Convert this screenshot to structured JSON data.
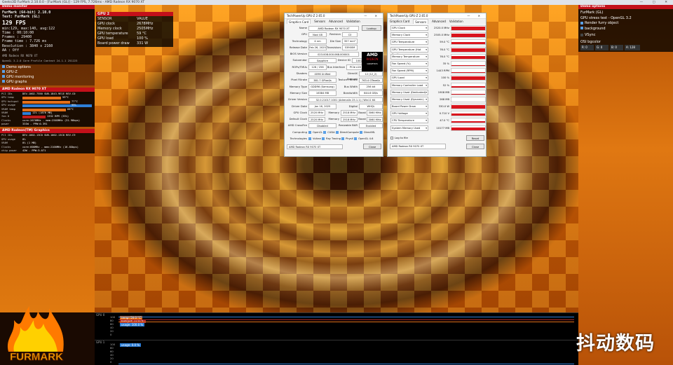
{
  "titlebar": {
    "text": "Geeks3D FurMark 2.10.0.0 - [FurMark (GL)] - 129 FPS, 7.726ms - AMD Radeon RX 9070 XT",
    "controls": "— ▢ ✕"
  },
  "left": {
    "demo_monitor_header": "Demo monitor",
    "monitor": {
      "app": "FurMark (64-bit) 2.10.0",
      "test": "Test: FurMark (GL)",
      "fps": "129 FPS",
      "fps_stats": "min:129, max:140, avg:122",
      "time": "Time         : 00:10:00",
      "frames": "Frames       : 29400",
      "frame_time": "Frame time   : 7.726 ms",
      "resolution": "Resolution   : 3840 x 2160",
      "aa": "AA           : Off",
      "gpu_name": "AMD Radeon RX 9070 XT",
      "gl": "OpenGL 3.2.0 Core Profile Context 24.1.1 251223"
    },
    "options": [
      "Demo options",
      "GPU-Z",
      "GPU monitoring",
      "GPU graphs"
    ],
    "gpu1": {
      "header": "AMD Radeon RX 9070 XT",
      "rows": [
        {
          "k": "PCI IDs",
          "v": "DEV-1002-7550 SUB-1843-9E1E REV-C0",
          "bar": 0,
          "c": ""
        },
        {
          "k": "GPU temp",
          "v": "59°C",
          "bar": 55,
          "c": "orange"
        },
        {
          "k": "GPU hotspot",
          "v": "77°C",
          "bar": 68,
          "c": "orange"
        },
        {
          "k": "GPU usage",
          "v": "99%",
          "bar": 99,
          "c": "blue"
        },
        {
          "k": "VRAM temp",
          "v": "68°C",
          "bar": 62,
          "c": "orange"
        },
        {
          "k": "VRAM",
          "v": "12% (1876 MB)",
          "bar": 12,
          "c": "blue"
        },
        {
          "k": "fan 0",
          "v": "1332 RPM (33%)",
          "bar": 33,
          "c": "red"
        },
        {
          "k": "Clocks",
          "v": "core:2670MHz - mem:2505MHz (31.98bps)",
          "bar": 0,
          "c": ""
        },
        {
          "k": "power",
          "v": "331W - PPW:0.391",
          "bar": 0,
          "c": ""
        }
      ]
    },
    "gpu2": {
      "header": "AMD Radeon(TM) Graphics",
      "rows": [
        {
          "k": "PCI IDs",
          "v": "DEV-1002-13C0 SUB-1002-13C0 REV-C9",
          "bar": 0,
          "c": ""
        },
        {
          "k": "GPU usage",
          "v": "0%",
          "bar": 0,
          "c": ""
        },
        {
          "k": "VRAM",
          "v": "0% (1 MB)",
          "bar": 0,
          "c": ""
        },
        {
          "k": "Clocks",
          "v": "core:600MHz - mem:2100MHz (16.8Gbps)",
          "bar": 0,
          "c": ""
        },
        {
          "k": "chip power",
          "v": "42W - PPW:3.071",
          "bar": 0,
          "c": ""
        }
      ]
    }
  },
  "sensors": {
    "header": "GPU 2",
    "col1": "SENSOR",
    "col2": "VALUE",
    "rows": [
      [
        "GPU clock",
        "2678MHz"
      ],
      [
        "Memory clock",
        "2505MHz"
      ],
      [
        "GPU temperature",
        "59 °C"
      ],
      [
        "GPU load",
        "100 %"
      ],
      [
        "Board power draw",
        "331 W"
      ]
    ]
  },
  "gpuz": {
    "title": "TechPowerUp GPU-Z 2.65.0",
    "tabs": [
      "Graphics Card",
      "Sensors",
      "Advanced",
      "Validation"
    ],
    "lookup": "Lookup",
    "uefi": "UEFI",
    "fields": {
      "name": "AMD Radeon RX 9070 XT",
      "gpu": "Navi 48",
      "revision": "C0",
      "technology": "4 nm",
      "die_size": "357 mm²",
      "release_date": "Feb 26, 2025",
      "transistors": "53900M",
      "bios": "023.008.000.068.000001",
      "subvendor": "Sapphire",
      "device_id": "1002 7550 - 1DA2 E0CE",
      "rops_tmus": "128 / 256",
      "bus_interface": "PCIe x16 5.0 @ x16 5.0",
      "shaders": "4096 Unified",
      "directx": "12 (12_2)",
      "pixel_fillrate": "381.7 GPixel/s",
      "texture_fillrate": "763.4 GTexel/s",
      "memory_type": "GDDR6 (Samsung)",
      "bus_width": "256 bit",
      "memory_size": "16384 MB",
      "bandwidth": "644.6 GB/s",
      "driver_version": "32.0.21017.1001 (Adrenalin 25.1.1) / Win11 64",
      "driver_date": "Jan 16, 2025",
      "digital_signature": "WHQL",
      "gpu_clock": "2520 MHz",
      "mem_clock": "2518 MHz",
      "boost": "3060 MHz",
      "def_gpu_clock": "2520 MHz",
      "def_mem_clock": "2518 MHz",
      "def_boost": "3060 MHz",
      "crossfire": "Disabled",
      "resizable_bar": "Enabled"
    },
    "labels": {
      "name": "Name",
      "gpu": "GPU",
      "revision": "Revision",
      "technology": "Technology",
      "die_size": "Die Size",
      "release_date": "Release Date",
      "transistors": "Transistors",
      "bios": "BIOS Version",
      "subvendor": "Subvendor",
      "device_id": "Device ID",
      "rops": "ROPs/TMUs",
      "bus": "Bus Interface",
      "shaders": "Shaders",
      "directx": "DirectX Support",
      "pixel": "Pixel Fillrate",
      "texture": "Texture Fillrate",
      "memtype": "Memory Type",
      "buswidth": "Bus Width",
      "memsize": "Memory Size",
      "bandwidth": "Bandwidth",
      "driver": "Driver Version",
      "driverdate": "Driver Date",
      "digsig": "Digital Signature",
      "gpuclock": "GPU Clock",
      "memory": "Memory",
      "boost": "Boost",
      "defclock": "Default Clock",
      "crossfire": "AMD CrossFire",
      "rebar": "Resizable BAR",
      "computing": "Computing",
      "technologies": "Technologies"
    },
    "computing": [
      "OpenCL",
      "CUDA",
      "DirectCompute",
      "DirectML"
    ],
    "technologies": [
      "Vulkan",
      "Ray Tracing",
      "PhysX",
      "OpenGL 4.6"
    ],
    "footer_select": "AMD Radeon RX 9070 XT",
    "close": "Close",
    "amd_logo": "AMD",
    "radeon": "RADEON",
    "graphics": "GRAPHICS"
  },
  "gpuz2": {
    "title": "TechPowerUp GPU-Z 2.65.0",
    "tabs": [
      "Graphics Card",
      "Sensors",
      "Advanced",
      "Validation"
    ],
    "sensors": [
      {
        "n": "GPU Clock",
        "v": "2520.0 MHz",
        "f": 0.85
      },
      {
        "n": "Memory Clock",
        "v": "2505.0 MHz",
        "f": 0.8
      },
      {
        "n": "GPU Temperature",
        "v": "59.0 °C",
        "f": 0.55
      },
      {
        "n": "GPU Temperature (Hot Spot)",
        "v": "76.0 °C",
        "f": 0.7
      },
      {
        "n": "Memory Temperature",
        "v": "76.0 °C",
        "f": 0.65
      },
      {
        "n": "Fan Speed (%)",
        "v": "35 %",
        "f": 0.1
      },
      {
        "n": "Fan Speed (RPM)",
        "v": "1443 RPM",
        "f": 0.15
      },
      {
        "n": "GPU Load",
        "v": "100 %",
        "f": 0.9
      },
      {
        "n": "Memory Controller Load",
        "v": "52 %",
        "f": 0.25
      },
      {
        "n": "Memory Used (Dedicated)",
        "v": "1908 MB",
        "f": 0.1
      },
      {
        "n": "Memory Used (Dynamic)",
        "v": "268 MB",
        "f": 0.05
      },
      {
        "n": "Board Power Draw",
        "v": "330.0 W",
        "f": 0.85
      },
      {
        "n": "GPU Voltage",
        "v": "0.710 V",
        "f": 0.6
      },
      {
        "n": "CPU Temperature",
        "v": "47.0 °C",
        "f": 0.45
      },
      {
        "n": "System Memory Used",
        "v": "10177 MB",
        "f": 0.55
      }
    ],
    "log": "Log to file",
    "reset": "Reset",
    "select": "AMD Radeon RX 9070 XT",
    "close": "Close"
  },
  "right": {
    "header": "Demo options",
    "test": "FurMark (GL)",
    "api": "GPU stress test - OpenGL 3.2",
    "options": [
      "Render furry object",
      "background"
    ],
    "vsync": "VSync",
    "bgcolor": "OSI bgcolor",
    "rgba": [
      "R: 0",
      "G: 0",
      "B: 0",
      "A: 128"
    ]
  },
  "graphs": {
    "gpu0": "GPU 0",
    "gpu1": "GPU 1",
    "axis": [
      "100",
      "80",
      "60",
      "40",
      "20",
      "0"
    ],
    "legend0": [
      {
        "t": "temp: 59.0 °C",
        "c": "#e36f1a"
      },
      {
        "t": "hotspot: 77.0 °C",
        "c": "#b02828"
      },
      {
        "t": "usage: 100.0 %",
        "c": "#2e7fd8"
      }
    ],
    "legend1": [
      {
        "t": "usage: 0.0 %",
        "c": "#2e7fd8"
      }
    ]
  },
  "logo_text": "FURMARK",
  "watermark": "抖动数码"
}
